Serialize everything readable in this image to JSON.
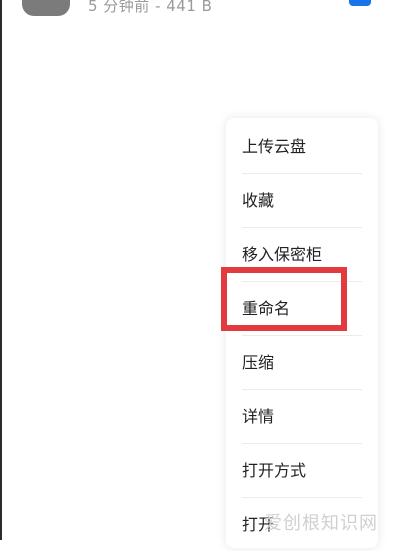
{
  "file_row": {
    "meta": "5 分钟前 - 441 B",
    "thumb_icon": "file-thumbnail-icon",
    "selected": true
  },
  "context_menu": {
    "items": [
      {
        "label": "上传云盘"
      },
      {
        "label": "收藏"
      },
      {
        "label": "移入保密柜"
      },
      {
        "label": "重命名"
      },
      {
        "label": "压缩"
      },
      {
        "label": "详情"
      },
      {
        "label": "打开方式"
      },
      {
        "label": "打开"
      }
    ],
    "highlighted_item": "重命名"
  },
  "watermark": "爱创根知识网",
  "colors": {
    "highlight_border": "#e23b3f",
    "checkbox": "#1a73e8",
    "menu_text": "#222222",
    "meta_text": "#9a9a9a"
  }
}
